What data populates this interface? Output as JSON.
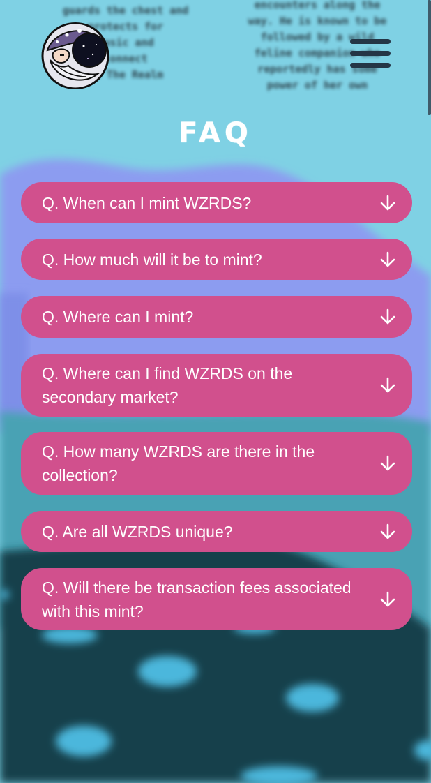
{
  "background_text": {
    "left": "guards the chest and\nprotects for\nmusic and\nconnect\nin The Realm",
    "right": "encounters along the\nway. He is known to be\nfollowed by a wild\nfeline companion who\nreportedly has some\npower of her own"
  },
  "header": {
    "logo_icon": "wizard-avatar-logo",
    "menu_icon": "hamburger-menu-icon"
  },
  "faq": {
    "title": "FAQ",
    "items": [
      {
        "question": "Q. When can I mint WZRDS?"
      },
      {
        "question": "Q. How much will it be to mint?"
      },
      {
        "question": "Q. Where can I mint?"
      },
      {
        "question": "Q. Where can I find WZRDS on the secondary market?"
      },
      {
        "question": "Q. How many WZRDS are there in the collection?"
      },
      {
        "question": "Q. Are all WZRDS unique?"
      },
      {
        "question": "Q. Will there be transaction fees associated with this mint?"
      }
    ],
    "arrow_icon": "arrow-down-icon"
  },
  "colors": {
    "sky": "#7fd1e4",
    "hill": "#8c9cf0",
    "ground_teal": "#49a2b4",
    "ground_dark": "#173f4c",
    "accordion": "#d1508d",
    "text": "#ffffff"
  }
}
